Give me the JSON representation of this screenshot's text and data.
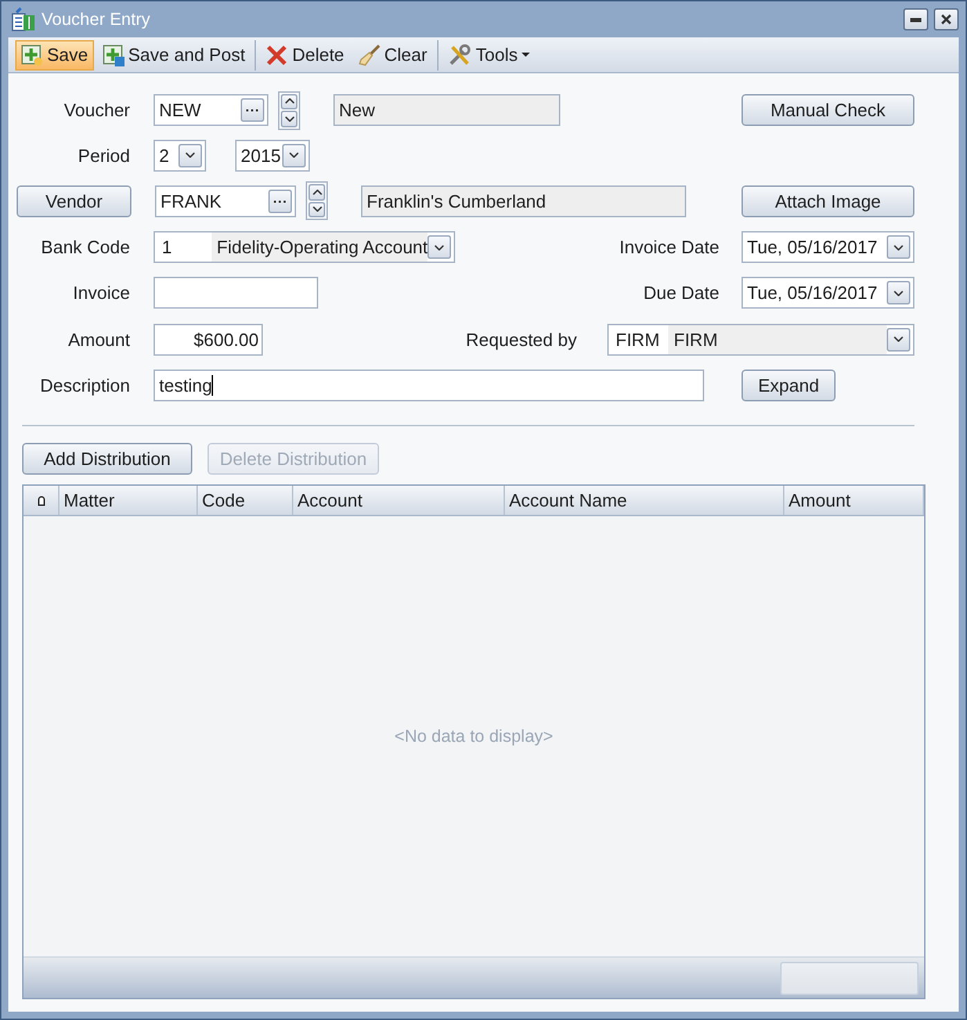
{
  "window": {
    "title": "Voucher Entry"
  },
  "toolbar": [
    {
      "items": [
        {
          "kind": "save",
          "label": "Save",
          "hovered": true
        },
        {
          "kind": "post",
          "label": "Save and Post",
          "hovered": false
        }
      ]
    },
    {
      "items": [
        {
          "kind": "delete",
          "label": "Delete",
          "hovered": false
        },
        {
          "kind": "clear",
          "label": "Clear",
          "hovered": false
        }
      ]
    },
    {
      "items": [
        {
          "kind": "tools",
          "label": "Tools",
          "hovered": false
        }
      ]
    }
  ],
  "form": {
    "voucher": {
      "label": "Voucher",
      "value": "NEW",
      "status": "New"
    },
    "manual_check": {
      "label": "Manual Check"
    },
    "period": {
      "label": "Period",
      "month": "2",
      "year": "2015"
    },
    "vendor": {
      "label": "Vendor",
      "value": "FRANK",
      "name": "Franklin's Cumberland"
    },
    "attach_image": {
      "label": "Attach Image"
    },
    "bank_code": {
      "label": "Bank Code",
      "code": "1",
      "name": "Fidelity-Operating Account"
    },
    "invoice_date": {
      "label": "Invoice Date",
      "value": "Tue, 05/16/2017"
    },
    "invoice": {
      "label": "Invoice"
    },
    "due_date": {
      "label": "Due Date",
      "value": "Tue, 05/16/2017"
    },
    "amount": {
      "label": "Amount",
      "value": "$600.00"
    },
    "requested_by": {
      "label": "Requested by",
      "code": "FIRM",
      "name": "FIRM"
    },
    "description": {
      "label": "Description",
      "value": "testing"
    },
    "expand": {
      "label": "Expand"
    }
  },
  "distribution_buttons": [
    {
      "label": "Add Distribution",
      "disabled": false
    },
    {
      "label": "Delete Distribution",
      "disabled": true
    }
  ],
  "grid": {
    "columns": [
      "Matter",
      "Code",
      "Account",
      "Account Name",
      "Amount"
    ],
    "empty_text": "<No data to display>"
  }
}
